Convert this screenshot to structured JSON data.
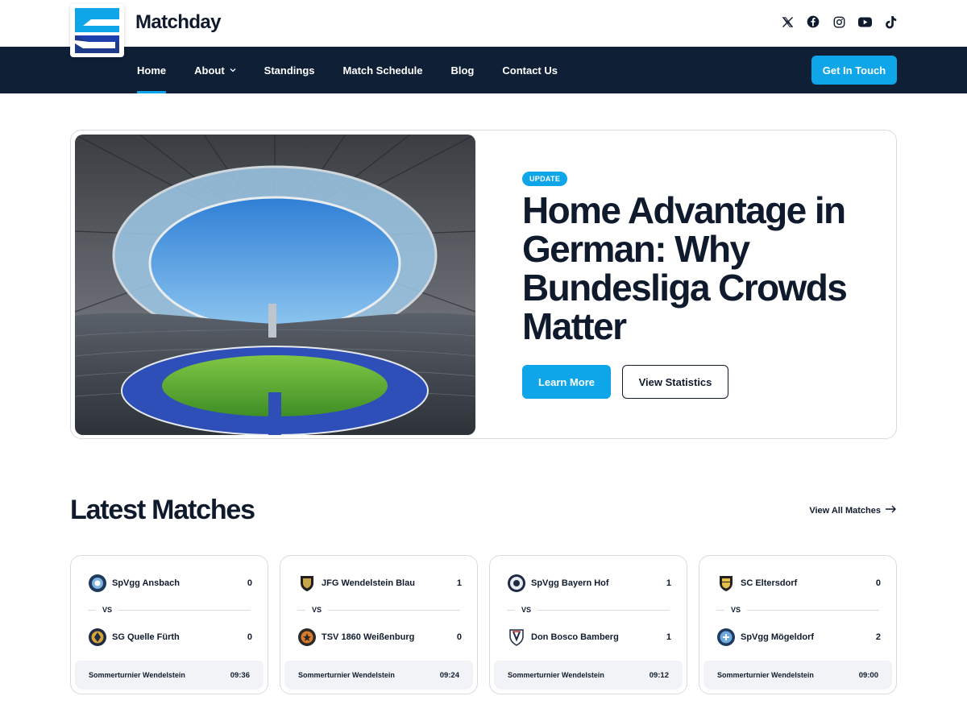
{
  "brand": {
    "name": "Matchday"
  },
  "socials": [
    {
      "name": "x-icon"
    },
    {
      "name": "facebook-icon"
    },
    {
      "name": "instagram-icon"
    },
    {
      "name": "youtube-icon"
    },
    {
      "name": "tiktok-icon"
    }
  ],
  "nav": {
    "items": [
      {
        "label": "Home",
        "active": true
      },
      {
        "label": "About",
        "has_dropdown": true
      },
      {
        "label": "Standings"
      },
      {
        "label": "Match Schedule"
      },
      {
        "label": "Blog"
      },
      {
        "label": "Contact Us"
      }
    ],
    "cta_label": "Get In Touch"
  },
  "hero": {
    "badge": "UPDATE",
    "title": "Home Advantage in German: Why Bundesliga Crowds Matter",
    "primary_button": "Learn More",
    "secondary_button": "View Statistics"
  },
  "matches_section": {
    "title": "Latest Matches",
    "view_all_label": "View All Matches",
    "vs_label": "VS",
    "matches": [
      {
        "home": "SpVgg Ansbach",
        "home_score": "0",
        "away": "SG Quelle Fürth",
        "away_score": "0",
        "competition": "Sommerturnier Wendelstein",
        "time": "09:36"
      },
      {
        "home": "JFG Wendelstein Blau",
        "home_score": "1",
        "away": "TSV 1860 Weißenburg",
        "away_score": "0",
        "competition": "Sommerturnier Wendelstein",
        "time": "09:24"
      },
      {
        "home": "SpVgg Bayern Hof",
        "home_score": "1",
        "away": "Don Bosco Bamberg",
        "away_score": "1",
        "competition": "Sommerturnier Wendelstein",
        "time": "09:12"
      },
      {
        "home": "SC Eltersdorf",
        "home_score": "0",
        "away": "SpVgg Mögeldorf",
        "away_score": "2",
        "competition": "Sommerturnier Wendelstein",
        "time": "09:00"
      }
    ]
  },
  "colors": {
    "accent": "#0ea5e9",
    "navy": "#0e1f36",
    "text": "#0f1b2d",
    "border": "#d7dbe1"
  }
}
